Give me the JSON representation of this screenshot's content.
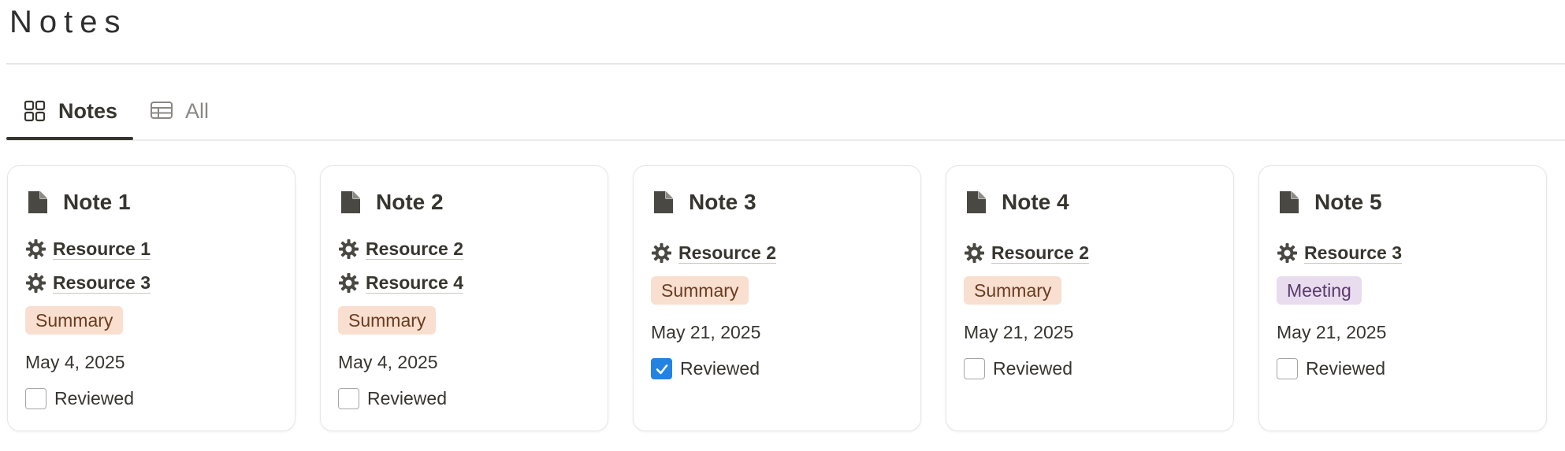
{
  "page": {
    "title": "Notes"
  },
  "tabs": [
    {
      "label": "Notes",
      "icon": "gallery-icon",
      "active": true
    },
    {
      "label": "All",
      "icon": "table-icon",
      "active": false
    }
  ],
  "colors": {
    "summary_tag_bg": "#f9dfcf",
    "meeting_tag_bg": "#e9dcef",
    "checkbox_checked": "#2383e2"
  },
  "cards": [
    {
      "title": "Note 1",
      "resources": [
        "Resource 1",
        "Resource 3"
      ],
      "tag": "Summary",
      "date": "May 4, 2025",
      "reviewed_label": "Reviewed",
      "reviewed": false
    },
    {
      "title": "Note 2",
      "resources": [
        "Resource 2",
        "Resource 4"
      ],
      "tag": "Summary",
      "date": "May 4, 2025",
      "reviewed_label": "Reviewed",
      "reviewed": false
    },
    {
      "title": "Note 3",
      "resources": [
        "Resource 2"
      ],
      "tag": "Summary",
      "date": "May 21, 2025",
      "reviewed_label": "Reviewed",
      "reviewed": true
    },
    {
      "title": "Note 4",
      "resources": [
        "Resource 2"
      ],
      "tag": "Summary",
      "date": "May 21, 2025",
      "reviewed_label": "Reviewed",
      "reviewed": false
    },
    {
      "title": "Note 5",
      "resources": [
        "Resource 3"
      ],
      "tag": "Meeting",
      "date": "May 21, 2025",
      "reviewed_label": "Reviewed",
      "reviewed": false
    }
  ]
}
